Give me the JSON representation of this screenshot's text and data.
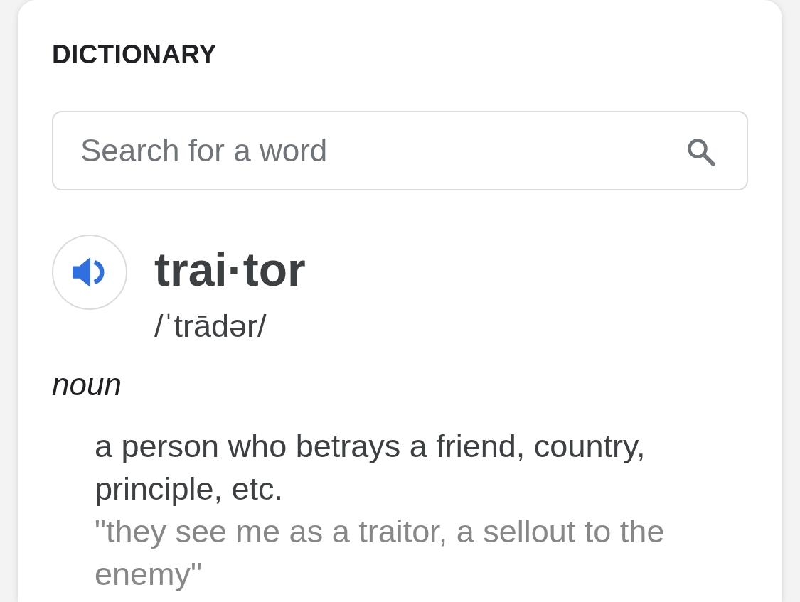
{
  "panel": {
    "title": "DICTIONARY"
  },
  "search": {
    "placeholder": "Search for a word"
  },
  "entry": {
    "headword": "trai·tor",
    "pronunciation": "/ˈtrādər/",
    "part_of_speech": "noun",
    "definitions": [
      {
        "text": "a person who betrays a friend, country, principle, etc.",
        "example": "\"they see me as a traitor, a sellout to the enemy\""
      }
    ]
  }
}
